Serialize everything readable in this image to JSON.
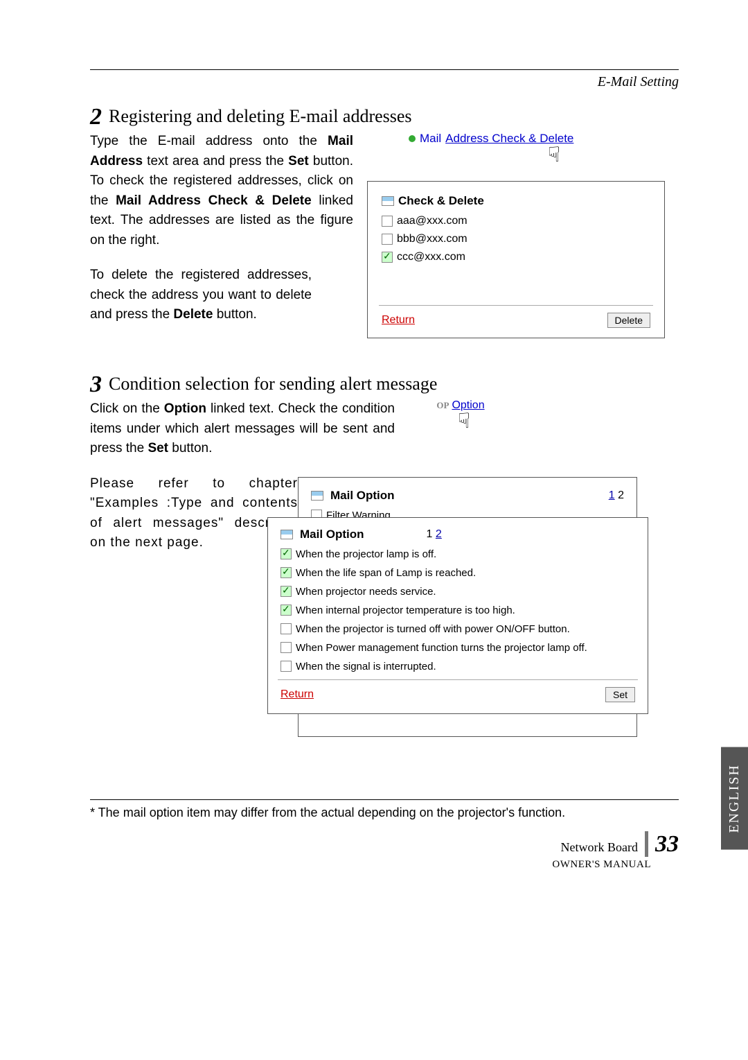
{
  "header": {
    "section_label": "E-Mail Setting"
  },
  "step2": {
    "num": "2",
    "title": "Registering and deleting E-mail addresses",
    "p1_a": "Type the E-mail address onto the ",
    "p1_b": "Mail Address",
    "p1_c": " text area and press the ",
    "p1_d": "Set",
    "p1_e": " button. To check the registered addresses, click on the ",
    "p1_f": "Mail Address Check & Delete",
    "p1_g": " linked text. The addresses are listed as the figure on the right.",
    "p2_a": "To delete the registered addresses, check the address you want to delete and press the ",
    "p2_b": "Delete",
    "p2_c": " button.",
    "link_prefix": "Mail ",
    "link_underline": "Address Check & Delete",
    "window": {
      "title": "Check & Delete",
      "addresses": [
        {
          "label": "aaa@xxx.com",
          "checked": false
        },
        {
          "label": "bbb@xxx.com",
          "checked": false
        },
        {
          "label": "ccc@xxx.com",
          "checked": true
        }
      ],
      "return": "Return",
      "delete": "Delete"
    }
  },
  "step3": {
    "num": "3",
    "title": "Condition selection for sending alert message",
    "p1_a": "Click on the ",
    "p1_b": "Option",
    "p1_c": " linked text. Check the condition items under which alert messages will be sent and press the ",
    "p1_d": "Set",
    "p1_e": " button.",
    "p2": "Please refer to chapter \"Examples :Type and contents of alert messages\" described on the next page.",
    "op_icon": "OP",
    "op_link": "Option",
    "small_win": {
      "title": "Mail Option",
      "pager_cur": "1",
      "pager_other": "2",
      "row1": "Filter Warning."
    },
    "large_win": {
      "title": "Mail Option",
      "pager_other": "1",
      "pager_cur": "2",
      "rows": [
        {
          "label": "When the projector lamp is off.",
          "checked": true
        },
        {
          "label": "When the life span of Lamp is reached.",
          "checked": true
        },
        {
          "label": "When projector needs service.",
          "checked": true
        },
        {
          "label": "When internal projector temperature is too high.",
          "checked": true
        },
        {
          "label": "When the projector is turned off with power ON/OFF button.",
          "checked": false
        },
        {
          "label": "When Power management function turns the projector lamp off.",
          "checked": false
        },
        {
          "label": "When the signal is interrupted.",
          "checked": false
        }
      ],
      "return": "Return",
      "set": "Set"
    }
  },
  "lang_tab": "ENGLISH",
  "footnote": "* The mail option item may differ from the actual depending on the projector's function.",
  "footer": {
    "nb": "Network Board",
    "page": "33",
    "om": "OWNER'S MANUAL"
  }
}
